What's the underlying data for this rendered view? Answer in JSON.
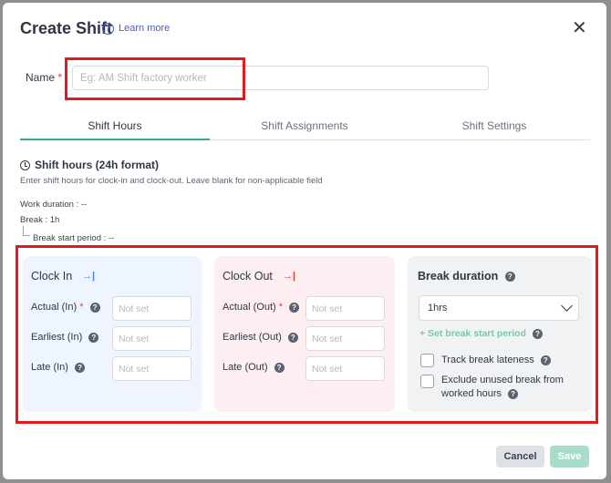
{
  "dialog": {
    "title": "Create Shift",
    "learn_more": "Learn more",
    "close_glyph": "✕"
  },
  "name_field": {
    "label": "Name",
    "required_mark": "*",
    "value": "",
    "placeholder": "Eg: AM Shift factory worker"
  },
  "tabs": [
    {
      "label": "Shift Hours",
      "active": true
    },
    {
      "label": "Shift Assignments",
      "active": false
    },
    {
      "label": "Shift Settings",
      "active": false
    }
  ],
  "shift_hours": {
    "title": "Shift hours (24h format)",
    "description": "Enter shift hours for clock-in and clock-out. Leave blank for non-applicable field",
    "work_duration": "Work duration : --",
    "break": "Break : 1h",
    "break_start_period": "Break start period : --"
  },
  "clock_in": {
    "title": "Clock In",
    "icon": "clock-in-arrow-icon",
    "actual_label": "Actual (In)",
    "earliest_label": "Earliest (In)",
    "late_label": "Late (In)",
    "placeholder": "Not set",
    "actual_value": "",
    "earliest_value": "",
    "late_value": ""
  },
  "clock_out": {
    "title": "Clock Out",
    "icon": "clock-out-arrow-icon",
    "actual_label": "Actual (Out)",
    "earliest_label": "Earliest (Out)",
    "late_label": "Late (Out)",
    "placeholder": "Not set",
    "actual_value": "",
    "earliest_value": "",
    "late_value": ""
  },
  "break_duration": {
    "title": "Break duration",
    "selected": "1hrs",
    "set_break_start": "+ Set break start period",
    "track_lateness": "Track break lateness",
    "track_lateness_checked": false,
    "exclude_unused_1": "Exclude unused break from",
    "exclude_unused_2": "worked hours",
    "exclude_unused_checked": false
  },
  "footer": {
    "cancel": "Cancel",
    "save": "Save"
  },
  "colors": {
    "accent_green": "#3aa88a",
    "link_blue": "#4c59c9",
    "highlight_red": "#e11b1b",
    "clock_in_panel": "#eef5fe",
    "clock_out_panel": "#fdeff1",
    "break_panel": "#f1f2f4"
  }
}
